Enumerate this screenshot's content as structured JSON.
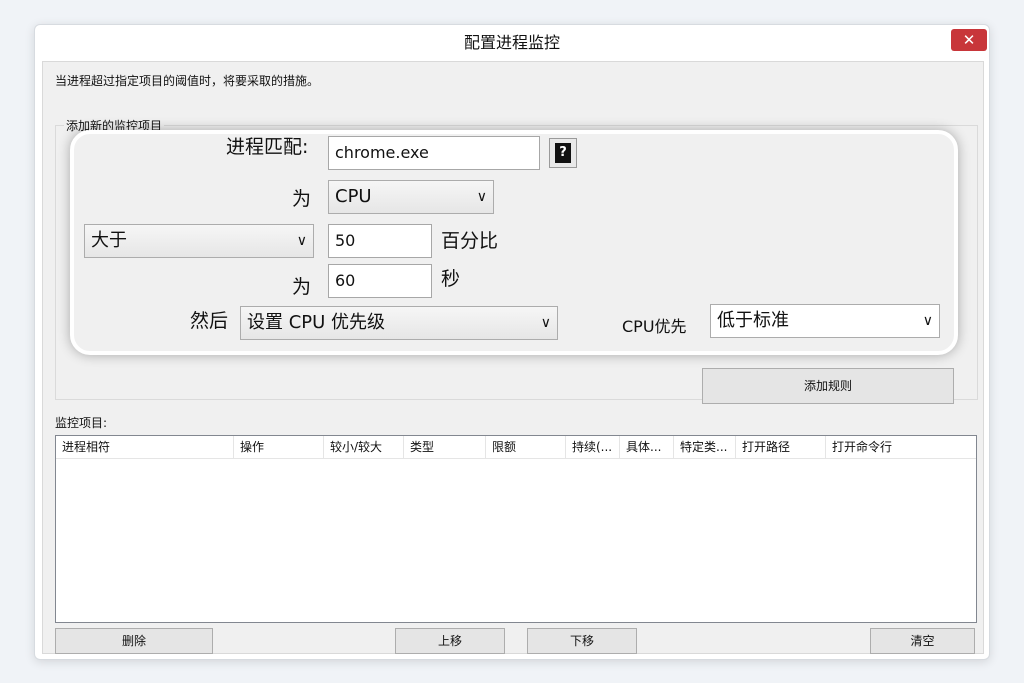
{
  "window": {
    "title": "配置进程监控",
    "close_glyph": "✕"
  },
  "description": "当进程超过指定项目的阈值时，将要采取的措施。",
  "group": {
    "title": "添加新的监控项目",
    "add_rule_label": "添加规则"
  },
  "panel": {
    "process_match_label": "进程匹配:",
    "process_match_value": "chrome.exe",
    "help_glyph": "?",
    "for_label_1": "为",
    "resource_select": "CPU",
    "comparison_select": "大于",
    "threshold_value": "50",
    "threshold_unit": "百分比",
    "for_label_2": "为",
    "duration_value": "60",
    "duration_unit": "秒",
    "then_label": "然后",
    "action_select": "设置 CPU 优先级",
    "cpu_priority_label": "CPU优先",
    "priority_select": "低于标准"
  },
  "monitor_list": {
    "label": "监控项目:",
    "columns": [
      "进程相符",
      "操作",
      "较小/较大",
      "类型",
      "限额",
      "持续(...",
      "具体...",
      "特定类...",
      "打开路径",
      "打开命令行"
    ]
  },
  "buttons": {
    "delete": "删除",
    "move_up": "上移",
    "move_down": "下移",
    "clear": "清空"
  },
  "colors": {
    "close_button": "#c8363a",
    "dialog_background": "#f0f0f0"
  },
  "icons": {
    "close": "close-icon",
    "help": "help-icon",
    "dropdown": "chevron-down-icon"
  }
}
